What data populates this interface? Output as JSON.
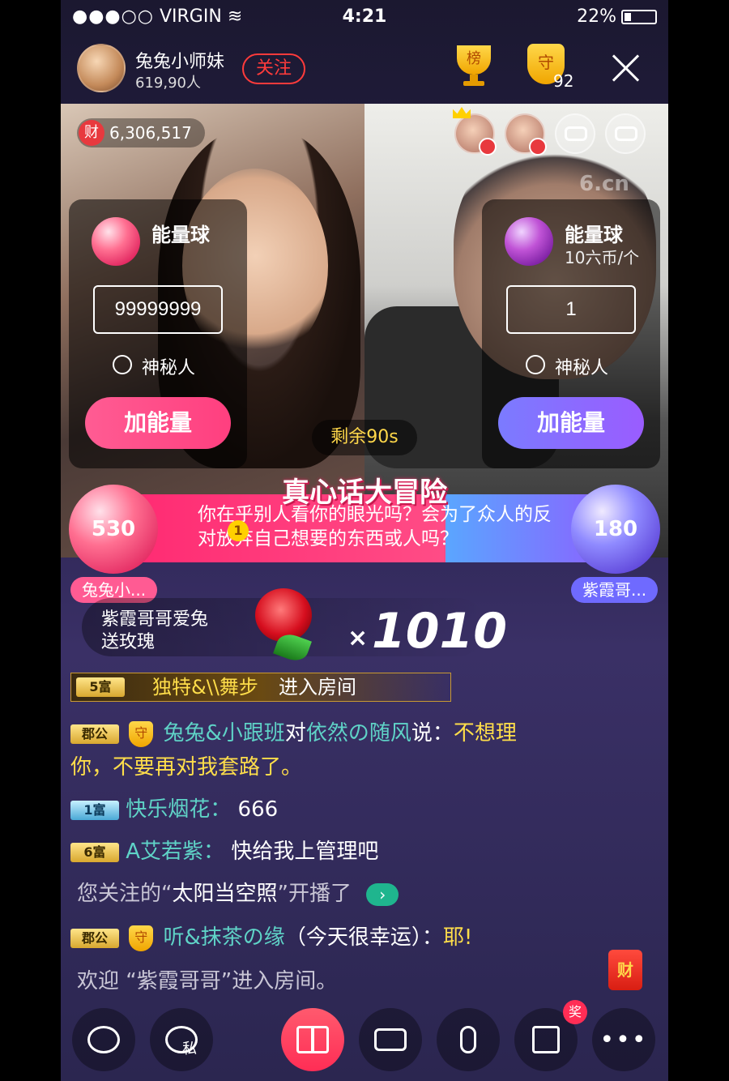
{
  "status_bar": {
    "carrier": "VIRGIN",
    "time": "4:21",
    "battery": "22%"
  },
  "header": {
    "host_name": "兔兔小师妹",
    "audience": "619,90人",
    "follow_label": "关注",
    "rank_label": "榜",
    "guard_label": "守",
    "guard_count": "92"
  },
  "video": {
    "wealth_icon": "财",
    "wealth_value": "6,306,517",
    "watermark": "6.cn"
  },
  "energy_left": {
    "title": "能量球",
    "input_value": "99999999",
    "radio_label": "神秘人",
    "button": "加能量"
  },
  "energy_right": {
    "title": "能量球",
    "price": "10六币/个",
    "input_value": "1",
    "radio_label": "神秘人",
    "button": "加能量"
  },
  "countdown": "剩余90s",
  "game": {
    "title": "真心话大冒险",
    "question_number": "1",
    "question": "你在乎别人看你的眼光吗？会为了众人的反对放弃自己想要的东西或人吗？",
    "left_votes": "530",
    "left_name": "兔兔小...",
    "right_votes": "180",
    "right_name": "紫霞哥..."
  },
  "gift": {
    "from": "紫霞哥哥爱兔",
    "action": "送玫瑰",
    "count": "1010"
  },
  "chat": {
    "enter_rank": "5富",
    "enter_user": "独特&\\\\舞步",
    "enter_text": "进入房间",
    "line1_rank": "郡公",
    "line1_user": "兔兔&小跟班",
    "line1_to": "对",
    "line1_target": "依然の随风",
    "line1_say": "说：",
    "line1_msg_a": "不想理",
    "line1_msg_b": "你，不要再对我套路了。",
    "line2_rank": "1富",
    "line2_user": "快乐烟花：",
    "line2_msg": "666",
    "line3_rank": "6富",
    "line3_user": "A艾若紫：",
    "line3_msg": "快给我上管理吧",
    "line4_msg_a": "您关注的“",
    "line4_name": "太阳当空照",
    "line4_msg_b": "”开播了",
    "line5_rank": "郡公",
    "line5_user": "听&抹茶の缘",
    "line5_mid": "（今天很幸运）：",
    "line5_msg": "耶!",
    "line6_msg": "欢迎 “紫霞哥哥”进入房间。"
  },
  "redpack_label": "财",
  "bottom": {
    "private_label": "私",
    "prize_badge": "奖"
  },
  "colors": {
    "pink": "#ff3f7f",
    "purple": "#9a5cff",
    "gold": "#ffd84a",
    "teal": "#5fd3c7"
  }
}
